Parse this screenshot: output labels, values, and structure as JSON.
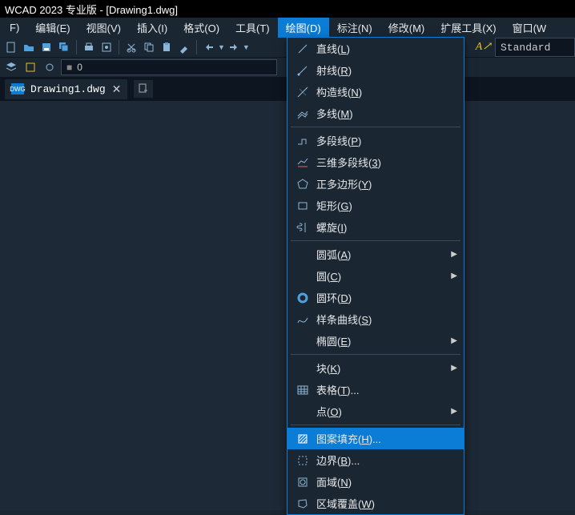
{
  "title": "WCAD 2023 专业版 - [Drawing1.dwg]",
  "menubar": [
    {
      "label": "F)",
      "active": false
    },
    {
      "label": "编辑(E)",
      "active": false
    },
    {
      "label": "视图(V)",
      "active": false
    },
    {
      "label": "插入(I)",
      "active": false
    },
    {
      "label": "格式(O)",
      "active": false
    },
    {
      "label": "工具(T)",
      "active": false
    },
    {
      "label": "绘图(D)",
      "active": true
    },
    {
      "label": "标注(N)",
      "active": false
    },
    {
      "label": "修改(M)",
      "active": false
    },
    {
      "label": "扩展工具(X)",
      "active": false
    },
    {
      "label": "窗口(W",
      "active": false
    }
  ],
  "layer_value": "0",
  "style_value": "Standard",
  "file_tab": {
    "name": "Drawing1.dwg",
    "icon_text": "DWG"
  },
  "dropdown": {
    "sections": [
      [
        {
          "icon": "line",
          "label": "直线(",
          "key": "L",
          "suffix": ")"
        },
        {
          "icon": "ray",
          "label": "射线(",
          "key": "R",
          "suffix": ")"
        },
        {
          "icon": "xline",
          "label": "构造线(",
          "key": "N",
          "suffix": ")"
        },
        {
          "icon": "mline",
          "label": "多线(",
          "key": "M",
          "suffix": ")"
        }
      ],
      [
        {
          "icon": "pline",
          "label": "多段线(",
          "key": "P",
          "suffix": ")"
        },
        {
          "icon": "3dpoly",
          "label": "三维多段线(",
          "key": "3",
          "suffix": ")"
        },
        {
          "icon": "polygon",
          "label": "正多边形(",
          "key": "Y",
          "suffix": ")"
        },
        {
          "icon": "rect",
          "label": "矩形(",
          "key": "G",
          "suffix": ")"
        },
        {
          "icon": "helix",
          "label": "螺旋(",
          "key": "I",
          "suffix": ")"
        }
      ],
      [
        {
          "icon": "",
          "label": "圆弧(",
          "key": "A",
          "suffix": ")",
          "submenu": true
        },
        {
          "icon": "",
          "label": "圆(",
          "key": "C",
          "suffix": ")",
          "submenu": true
        },
        {
          "icon": "donut",
          "label": "圆环(",
          "key": "D",
          "suffix": ")"
        },
        {
          "icon": "spline",
          "label": "样条曲线(",
          "key": "S",
          "suffix": ")"
        },
        {
          "icon": "",
          "label": "椭圆(",
          "key": "E",
          "suffix": ")",
          "submenu": true
        }
      ],
      [
        {
          "icon": "",
          "label": "块(",
          "key": "K",
          "suffix": ")",
          "submenu": true
        },
        {
          "icon": "table",
          "label": "表格(",
          "key": "T",
          "suffix": ")..."
        },
        {
          "icon": "",
          "label": "点(",
          "key": "O",
          "suffix": ")",
          "submenu": true
        }
      ],
      [
        {
          "icon": "hatch",
          "label": "图案填充(",
          "key": "H",
          "suffix": ")...",
          "highlighted": true
        },
        {
          "icon": "boundary",
          "label": "边界(",
          "key": "B",
          "suffix": ")..."
        },
        {
          "icon": "region",
          "label": "面域(",
          "key": "N",
          "suffix": ")"
        },
        {
          "icon": "wipeout",
          "label": "区域覆盖(",
          "key": "W",
          "suffix": ")"
        }
      ]
    ]
  }
}
